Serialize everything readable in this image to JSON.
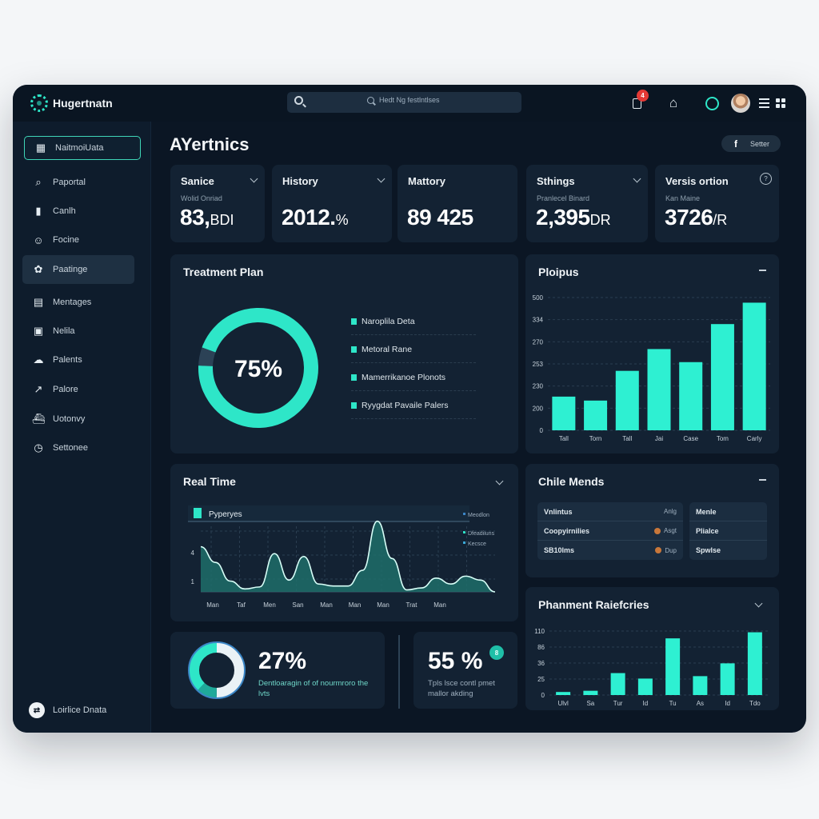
{
  "app": {
    "name": "Hugertnatn"
  },
  "search": {
    "placeholder": "Hedt Ng festlntlses"
  },
  "topbar": {
    "notification_count": "4"
  },
  "sidebar": {
    "items": [
      {
        "label": "NaitmoiUata",
        "icon": "calendar-icon",
        "state": "outlined"
      },
      {
        "label": "Paportal",
        "icon": "search-icon"
      },
      {
        "label": "Canlh",
        "icon": "device-icon"
      },
      {
        "label": "Focine",
        "icon": "robot-icon"
      },
      {
        "label": "Paatinge",
        "icon": "settings-gear-icon",
        "state": "active"
      },
      {
        "label": "Mentages",
        "icon": "message-icon"
      },
      {
        "label": "Nelila",
        "icon": "document-icon"
      },
      {
        "label": "Palents",
        "icon": "cloud-icon"
      },
      {
        "label": "Palore",
        "icon": "pin-icon"
      },
      {
        "label": "Uotonvy",
        "icon": "ship-icon"
      },
      {
        "label": "Settonee",
        "icon": "clock-icon"
      }
    ],
    "footer": {
      "label": "Loirlice Dnata",
      "icon": "exchange-icon"
    }
  },
  "header": {
    "title": "AYertnics",
    "share_label": "Setter",
    "share_icon": "facebook-icon"
  },
  "stats": [
    {
      "title": "Sanice",
      "sub": "Wolid Onriad",
      "value": "83,",
      "unit": "BDI",
      "control": "chevron"
    },
    {
      "title": "History",
      "sub": "",
      "value": "2012.",
      "unit": "%",
      "control": "chevron"
    },
    {
      "title": "Mattory",
      "sub": "",
      "value": "89 425",
      "unit": "",
      "control": "none"
    },
    {
      "title": "Sthings",
      "sub": "Pranlecel Binard",
      "value": "2,395",
      "unit": "DR",
      "control": "chevron"
    },
    {
      "title": "Versis ortion",
      "sub": "Kan Maine",
      "value": "3726",
      "unit": "/R",
      "control": "help"
    }
  ],
  "treatment_plan": {
    "title": "Treatment Plan",
    "percent_label": "75%",
    "progress": 0.95,
    "legend": [
      "Naroplila Deta",
      "Metoral Rane",
      "Mamerrikanoe Plonots",
      "Ryygdat Pavaile Palers"
    ]
  },
  "colors": {
    "accent": "#2ee6c8",
    "panel": "#132233",
    "bg": "#0b1624",
    "track": "#2c4256",
    "blue": "#3b86c6"
  },
  "chart_data": [
    {
      "id": "ploipus",
      "type": "bar",
      "title": "Ploipus",
      "categories": [
        "Tall",
        "Torn",
        "Tall",
        "Jai",
        "Case",
        "Tom",
        "Carly"
      ],
      "values": [
        85,
        75,
        150,
        205,
        172,
        268,
        322
      ],
      "yticks": [
        "0",
        "200",
        "230",
        "253",
        "270",
        "334",
        "500"
      ],
      "ylim": [
        0,
        335
      ],
      "grid": true
    },
    {
      "id": "real-time",
      "type": "area",
      "title": "Real Time",
      "legend_main": "Pyperyes",
      "legend_side": [
        "Meodlon",
        "Dfeadiluns",
        "Kecsce"
      ],
      "x": [
        "Man",
        "Taf",
        "Men",
        "San",
        "Man",
        "Man",
        "Man",
        "Trat",
        "Man"
      ],
      "yticks": [
        "1",
        "4"
      ],
      "values": [
        4.6,
        3.0,
        1.1,
        0.3,
        0.5,
        3.9,
        1.2,
        3.6,
        0.8,
        0.6,
        0.6,
        2.2,
        7.2,
        3.4,
        0.2,
        0.4,
        1.4,
        0.8,
        1.6,
        1.2,
        0.0
      ],
      "ylim": [
        0,
        7.5
      ],
      "grid": true
    },
    {
      "id": "phanment-raiefcries",
      "type": "bar",
      "title": "Phanment Raiefcries",
      "categories": [
        "Ulvl",
        "Sa",
        "Tur",
        "Id",
        "Tu",
        "As",
        "Id",
        "Tdo"
      ],
      "values": [
        5,
        7,
        36,
        27,
        93,
        31,
        52,
        103
      ],
      "yticks": [
        "0",
        "25",
        "36",
        "86",
        "110"
      ],
      "ylim": [
        0,
        105
      ],
      "grid": true
    }
  ],
  "chile_mends": {
    "title": "Chile Mends",
    "rows": [
      {
        "name": "Vnlintus",
        "meta": "Anlg"
      },
      {
        "name": "Coopyirnilies",
        "meta": "Asgt"
      },
      {
        "name": "SB10lms",
        "meta": "Dup"
      }
    ],
    "side_rows": [
      "Menle",
      "Plialce",
      "Spwlse"
    ]
  },
  "kpis": [
    {
      "value": "27%",
      "desc": "Dentloaragin of of nourmroro the lvts",
      "ring": [
        0.55,
        0.15,
        0.3
      ]
    },
    {
      "value": "55 %",
      "desc": "Tpls lsce contl pmet mallor akding",
      "badge": "8"
    }
  ]
}
